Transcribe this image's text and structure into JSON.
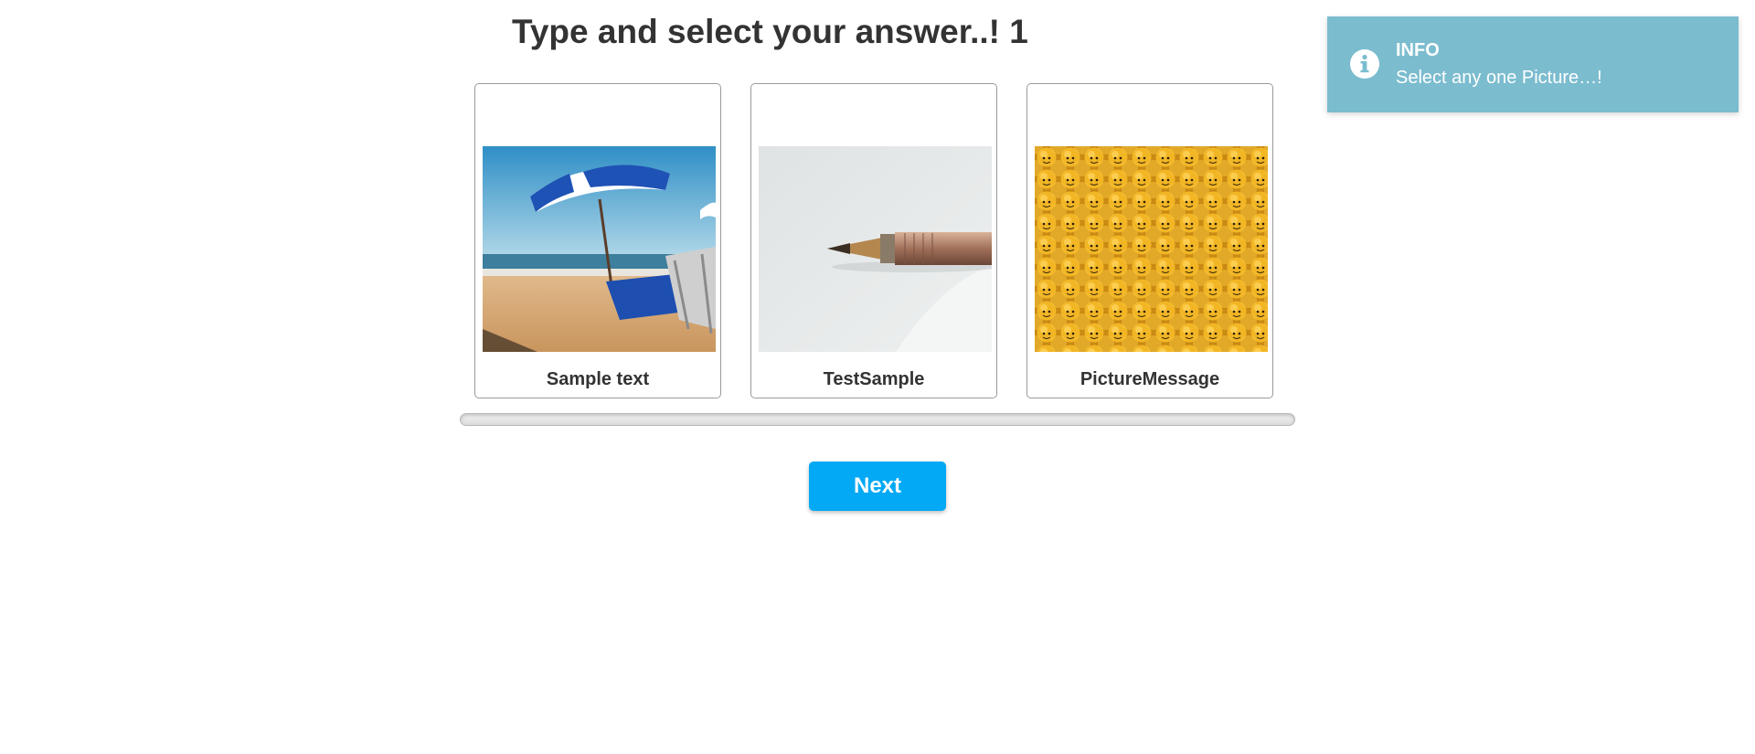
{
  "question": {
    "title": "Type and select your answer..! 1"
  },
  "options": [
    {
      "label": "Sample text",
      "image": "beach-umbrella-photo"
    },
    {
      "label": "TestSample",
      "image": "fountain-pen-photo"
    },
    {
      "label": "PictureMessage",
      "image": "yellow-toy-heads-photo"
    }
  ],
  "navigation": {
    "next_label": "Next"
  },
  "toast": {
    "icon": "info-icon",
    "title": "INFO",
    "message": "Select any one Picture…!",
    "color": "#7bbccf"
  },
  "colors": {
    "accent": "#03a9f4",
    "text": "#333333"
  }
}
